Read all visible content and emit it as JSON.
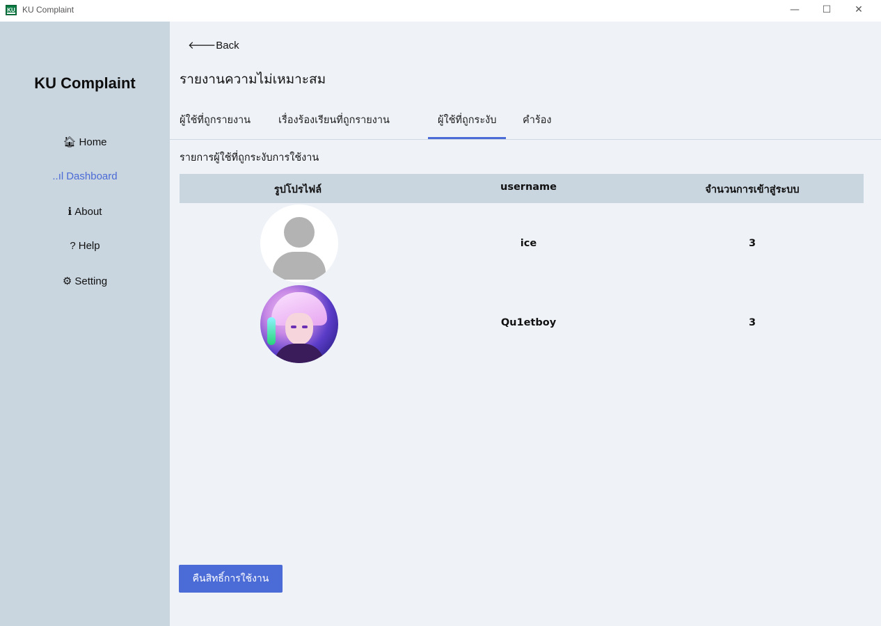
{
  "window": {
    "title": "KU Complaint",
    "logo_text": "KU",
    "minimize": "—",
    "maximize": "☐",
    "close": "✕"
  },
  "sidebar": {
    "brand": "KU Complaint",
    "items": [
      {
        "label": "Home",
        "icon": "home-icon",
        "glyph": "🏠︎"
      },
      {
        "label": "Dashboard",
        "icon": "signal-bars-icon",
        "glyph": "..ıl",
        "active": true
      },
      {
        "label": "About",
        "icon": "info-icon",
        "glyph": "ℹ"
      },
      {
        "label": "Help",
        "icon": "question-icon",
        "glyph": "?"
      },
      {
        "label": "Setting",
        "icon": "gear-icon",
        "glyph": "⚙"
      }
    ],
    "active_color": "#4b6bd6"
  },
  "main": {
    "back_label": "Back",
    "back_glyph": "🡐",
    "title": "รายงานความไม่เหมาะสม",
    "tabs": [
      {
        "label": "ผู้ใช้ที่ถูกรายงาน"
      },
      {
        "label": "เรื่องร้องเรียนที่ถูกรายงาน"
      },
      {
        "label": "ผู้ใช้ที่ถูกระงับ",
        "active": true
      },
      {
        "label": "คำร้อง"
      }
    ],
    "section_label": "รายการผู้ใช้ที่ถูกระงับการใช้งาน",
    "table": {
      "headers": [
        "รูปโปรไฟล์",
        "username",
        "จำนวนการเข้าสู่ระบบ"
      ],
      "rows": [
        {
          "avatar": "default-avatar",
          "username": "ice",
          "login_count": "3"
        },
        {
          "avatar": "anime-avatar",
          "username": "Qu1etboy",
          "login_count": "3"
        }
      ]
    },
    "restore_button": "คืนสิทธิ์การใช้งาน"
  }
}
